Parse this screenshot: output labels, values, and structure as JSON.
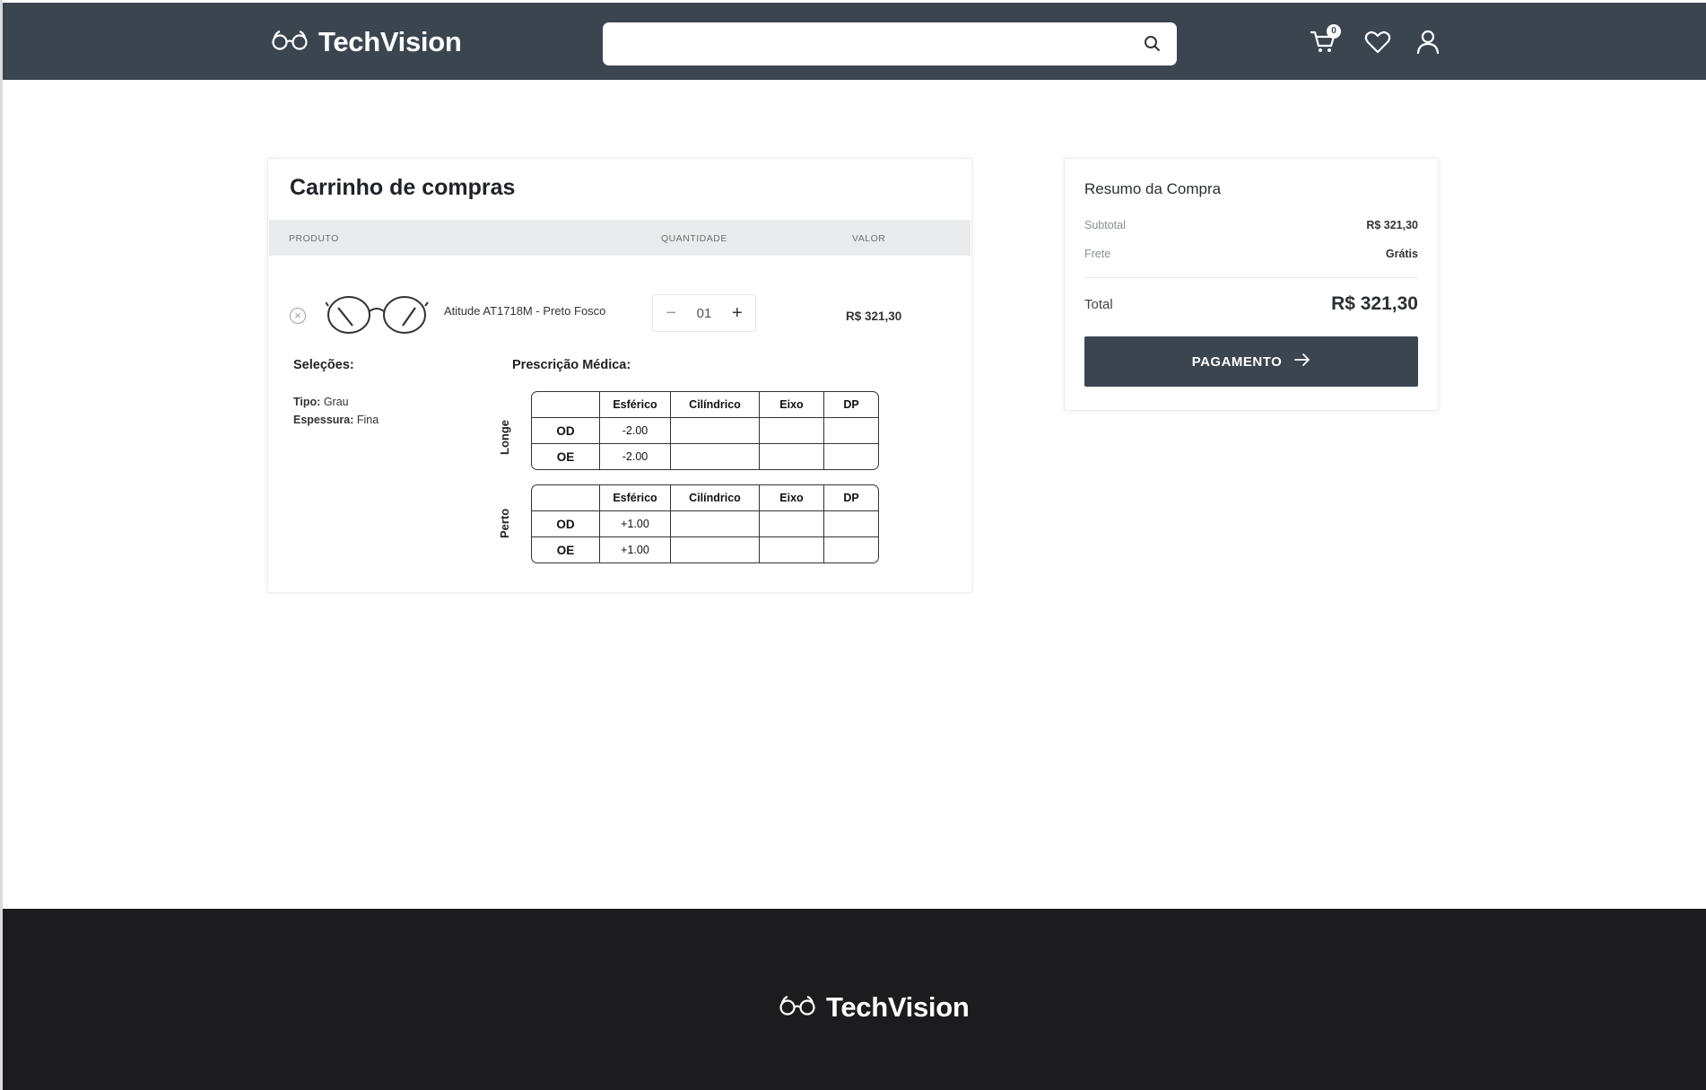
{
  "brand": {
    "name": "TechVision"
  },
  "header": {
    "search": {
      "placeholder": ""
    },
    "cart_count": "0"
  },
  "cart": {
    "title": "Carrinho de compras",
    "columns": {
      "product": "PRODUTO",
      "quantity": "QUANTIDADE",
      "value": "VALOR"
    },
    "item": {
      "name": "Atitude AT1718M - Preto Fosco",
      "quantity": "01",
      "price": "R$ 321,30"
    },
    "selections": {
      "heading": "Seleções:",
      "type_label": "Tipo:",
      "type_value": "Grau",
      "thickness_label": "Espessura:",
      "thickness_value": "Fina"
    },
    "prescription": {
      "heading": "Prescrição Médica:",
      "headers": [
        "Esférico",
        "Cilíndrico",
        "Eixo",
        "DP"
      ],
      "far": {
        "label": "Longe",
        "rows": [
          {
            "eye": "OD",
            "sph": "-2.00",
            "cyl": "",
            "axis": "",
            "dp": ""
          },
          {
            "eye": "OE",
            "sph": "-2.00",
            "cyl": "",
            "axis": "",
            "dp": ""
          }
        ]
      },
      "near": {
        "label": "Perto",
        "rows": [
          {
            "eye": "OD",
            "sph": "+1.00",
            "cyl": "",
            "axis": "",
            "dp": ""
          },
          {
            "eye": "OE",
            "sph": "+1.00",
            "cyl": "",
            "axis": "",
            "dp": ""
          }
        ]
      }
    }
  },
  "summary": {
    "title": "Resumo da Compra",
    "subtotal_label": "Subtotal",
    "subtotal_value": "R$ 321,30",
    "shipping_label": "Frete",
    "shipping_value": "Grátis",
    "total_label": "Total",
    "total_value": "R$ 321,30",
    "pay_label": "PAGAMENTO"
  },
  "colors": {
    "header": "#3b4550",
    "footer": "#1c1c1f",
    "button": "#3b4550"
  }
}
